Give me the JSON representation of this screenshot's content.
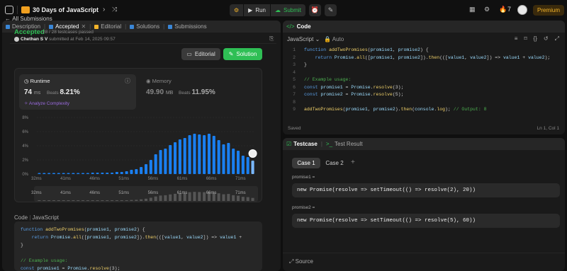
{
  "topbar": {
    "title": "30 Days of JavaScript",
    "run": "Run",
    "submit": "Submit",
    "streak": "7",
    "premium": "Premium"
  },
  "left_tabs": [
    "Description",
    "Accepted",
    "Editorial",
    "Solutions",
    "Submissions"
  ],
  "submission": {
    "back": "All Submissions",
    "status": "Accepted",
    "passed": "28 / 28 testcases passed",
    "author": "Chethan S V",
    "submitted": "submitted at Feb 14, 2025 09:57",
    "editorial_btn": "Editorial",
    "solution_btn": "Solution"
  },
  "runtime": {
    "label": "Runtime",
    "value": "74",
    "unit": "ms",
    "beats_label": "Beats",
    "beats": "8.21%",
    "analyze": "Analyze Complexity"
  },
  "memory": {
    "label": "Memory",
    "value": "49.90",
    "unit": "MB",
    "beats_label": "Beats",
    "beats": "11.95%"
  },
  "chart_data": {
    "type": "bar",
    "y_ticks": [
      "8%",
      "6%",
      "4%",
      "2%",
      "0%"
    ],
    "x_ticks": [
      "32ms",
      "41ms",
      "46ms",
      "51ms",
      "56ms",
      "61ms",
      "66ms",
      "71ms"
    ],
    "ylim": [
      0,
      8
    ],
    "values": [
      0.15,
      0.15,
      0.15,
      0.15,
      0.15,
      0.15,
      0.15,
      0.15,
      0.15,
      0.15,
      0.15,
      0.2,
      0.2,
      0.2,
      0.2,
      0.2,
      0.3,
      0.3,
      0.4,
      0.6,
      0.7,
      1.0,
      1.4,
      2.0,
      2.8,
      3.4,
      3.6,
      4.1,
      4.5,
      4.9,
      5.1,
      5.5,
      5.7,
      5.6,
      5.5,
      5.7,
      5.4,
      4.8,
      4.2,
      4.4,
      3.6,
      3.3,
      2.6,
      2.4,
      1.9
    ],
    "highlight_index": 44,
    "colors": {
      "bar": "#1a7ff0",
      "highlight": "#7ab8ff"
    }
  },
  "code_section": {
    "label": "Code",
    "lang": "JavaScript"
  },
  "left_code": [
    "function addTwoPromises(promise1, promise2) {",
    "    return Promise.all([promise1, promise2]).then(([value1, value2]) => value1 + ",
    "}",
    "",
    "// Example usage:",
    "const promise1 = Promise.resolve(3);"
  ],
  "right_panel": {
    "tab": "Code",
    "lang": "JavaScript",
    "auto": "Auto",
    "saved": "Saved",
    "position": "Ln 1, Col 1",
    "code": [
      "function addTwoPromises(promise1, promise2) {",
      "    return Promise.all([promise1, promise2]).then(([value1, value2]) => value1 + value2);",
      "}",
      "",
      "// Example usage:",
      "const promise1 = Promise.resolve(3);",
      "const promise2 = Promise.resolve(5);",
      "",
      "addTwoPromises(promise1, promise2).then(console.log); // Output: 8"
    ]
  },
  "testcase": {
    "tab": "Testcase",
    "result_tab": "Test Result",
    "cases": [
      "Case 1",
      "Case 2"
    ],
    "inputs": [
      {
        "label": "promise1 =",
        "value": "new Promise(resolve => setTimeout(() => resolve(2), 20))"
      },
      {
        "label": "promise2 =",
        "value": "new Promise(resolve => setTimeout(() => resolve(5), 60))"
      }
    ],
    "source": "Source"
  }
}
